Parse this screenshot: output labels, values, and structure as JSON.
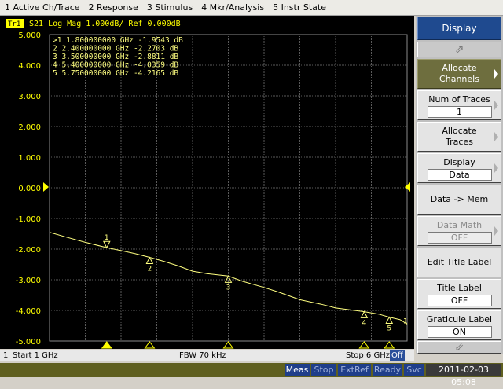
{
  "menu": [
    "1 Active Ch/Trace",
    "2 Response",
    "3 Stimulus",
    "4 Mkr/Analysis",
    "5 Instr State"
  ],
  "trace": {
    "id": "Tr1",
    "header": "S21 Log Mag 1.000dB/ Ref 0.000dB"
  },
  "markers": [
    {
      "num": "1",
      "active": true,
      "text": ">1   1.800000000 GHz -1.9543 dB"
    },
    {
      "num": "2",
      "active": false,
      "text": " 2   2.400000000 GHz -2.2703 dB"
    },
    {
      "num": "3",
      "active": false,
      "text": " 3   3.500000000 GHz -2.8811 dB"
    },
    {
      "num": "4",
      "active": false,
      "text": " 4   5.400000000 GHz -4.0359 dB"
    },
    {
      "num": "5",
      "active": false,
      "text": " 5   5.750000000 GHz -4.2165 dB"
    }
  ],
  "y_labels": [
    "5.000",
    "4.000",
    "3.000",
    "2.000",
    "1.000",
    "0.000",
    "-1.000",
    "-2.000",
    "-3.000",
    "-4.000",
    "-5.000"
  ],
  "end_marker_label": "1",
  "softkeys": {
    "display": "Display",
    "up": "⇗",
    "allocate_channels": [
      "Allocate",
      "Channels"
    ],
    "num_traces": {
      "label": "Num of Traces",
      "value": "1"
    },
    "allocate_traces": [
      "Allocate",
      "Traces"
    ],
    "display_mode": {
      "label": "Display",
      "value": "Data"
    },
    "data_mem": "Data -> Mem",
    "data_math": {
      "label": "Data Math",
      "value": "OFF"
    },
    "edit_title": "Edit Title Label",
    "title_label": {
      "label": "Title Label",
      "value": "OFF"
    },
    "graticule_label": {
      "label": "Graticule Label",
      "value": "ON"
    },
    "down": "⇙"
  },
  "channel_bar": {
    "ch": "1",
    "start": "Start 1 GHz",
    "ifbw": "IFBW 70 kHz",
    "stop": "Stop 6 GHz",
    "off": "Off"
  },
  "status": {
    "meas": "Meas",
    "stop": "Stop",
    "extref": "ExtRef",
    "ready": "Ready",
    "svc": "Svc",
    "clock": "2011-02-03 05:08"
  },
  "colors": {
    "trace": "#ffff80",
    "grid": "#606060",
    "axis_text": "#ffff00",
    "sel_key": "#6e6e3e",
    "title_key": "#1f4a8f"
  },
  "chart_data": {
    "type": "line",
    "x_unit": "GHz",
    "xlim": [
      1,
      6
    ],
    "ylim": [
      -5,
      5
    ],
    "x": [
      1.0,
      1.25,
      1.5,
      1.8,
      2.0,
      2.2,
      2.4,
      2.6,
      2.8,
      3.0,
      3.2,
      3.5,
      3.7,
      4.0,
      4.2,
      4.5,
      4.8,
      5.0,
      5.2,
      5.4,
      5.6,
      5.75,
      5.9,
      6.0
    ],
    "y": [
      -1.45,
      -1.62,
      -1.78,
      -1.95,
      -2.05,
      -2.15,
      -2.27,
      -2.4,
      -2.55,
      -2.72,
      -2.8,
      -2.88,
      -3.05,
      -3.25,
      -3.4,
      -3.65,
      -3.8,
      -3.92,
      -3.98,
      -4.04,
      -4.12,
      -4.22,
      -4.3,
      -4.45
    ],
    "markers": [
      [
        1.8,
        -1.9543
      ],
      [
        2.4,
        -2.2703
      ],
      [
        3.5,
        -2.8811
      ],
      [
        5.4,
        -4.0359
      ],
      [
        5.75,
        -4.2165
      ]
    ],
    "grid": true
  }
}
